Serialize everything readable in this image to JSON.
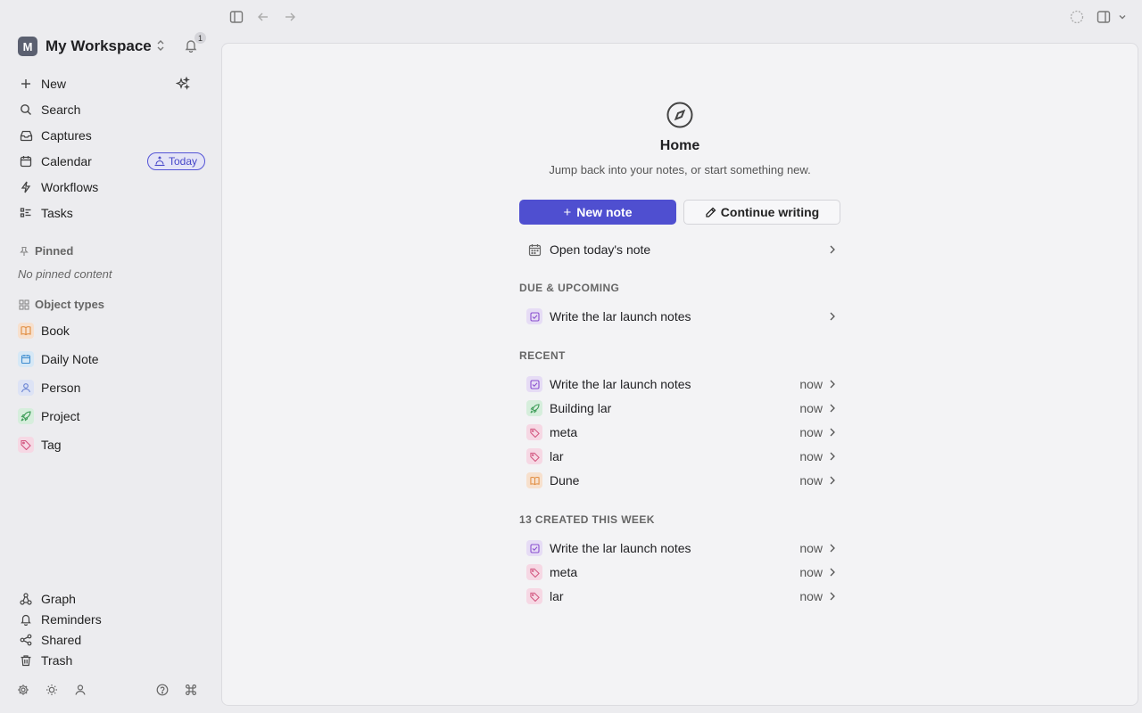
{
  "sidebar": {
    "workspace": {
      "initial": "M",
      "name": "My Workspace",
      "notification_count": "1"
    },
    "nav": [
      {
        "label": "New",
        "icon": "plus-icon"
      },
      {
        "label": "Search",
        "icon": "search-icon"
      },
      {
        "label": "Captures",
        "icon": "inbox-icon"
      },
      {
        "label": "Calendar",
        "icon": "calendar-icon"
      },
      {
        "label": "Workflows",
        "icon": "bolt-icon"
      },
      {
        "label": "Tasks",
        "icon": "checklist-icon"
      }
    ],
    "today_label": "Today",
    "pinned": {
      "header": "Pinned",
      "empty": "No pinned content"
    },
    "object_types": {
      "header": "Object types",
      "items": [
        {
          "label": "Book",
          "icon": "book-icon",
          "color": "#e08a3c"
        },
        {
          "label": "Daily Note",
          "icon": "calendar-icon",
          "color": "#3e8ccf"
        },
        {
          "label": "Person",
          "icon": "person-icon",
          "color": "#6680d2"
        },
        {
          "label": "Project",
          "icon": "rocket-icon",
          "color": "#3a9a55"
        },
        {
          "label": "Tag",
          "icon": "tag-icon",
          "color": "#d2557f"
        }
      ]
    },
    "bottom": [
      {
        "label": "Graph",
        "icon": "graph-icon"
      },
      {
        "label": "Reminders",
        "icon": "bell-icon"
      },
      {
        "label": "Shared",
        "icon": "share-icon"
      },
      {
        "label": "Trash",
        "icon": "trash-icon"
      }
    ]
  },
  "main": {
    "title": "Home",
    "subtitle": "Jump back into your notes, or start something new.",
    "new_note_label": "New note",
    "continue_label": "Continue writing",
    "open_today_label": "Open today's note",
    "due": {
      "header": "DUE & UPCOMING",
      "items": [
        {
          "title": "Write the lar launch notes",
          "type": "task"
        }
      ]
    },
    "recent": {
      "header": "RECENT",
      "items": [
        {
          "title": "Write the lar launch notes",
          "time": "now",
          "type": "task"
        },
        {
          "title": "Building lar",
          "time": "now",
          "type": "project"
        },
        {
          "title": "meta",
          "time": "now",
          "type": "tag"
        },
        {
          "title": "lar",
          "time": "now",
          "type": "tag"
        },
        {
          "title": "Dune",
          "time": "now",
          "type": "book"
        }
      ]
    },
    "created": {
      "header": "13 CREATED THIS WEEK",
      "items": [
        {
          "title": "Write the lar launch notes",
          "time": "now",
          "type": "task"
        },
        {
          "title": "meta",
          "time": "now",
          "type": "tag"
        },
        {
          "title": "lar",
          "time": "now",
          "type": "tag"
        }
      ]
    }
  },
  "colors": {
    "accent": "#4f4fd0",
    "background": "#ececef",
    "panel": "#f3f3f5"
  }
}
